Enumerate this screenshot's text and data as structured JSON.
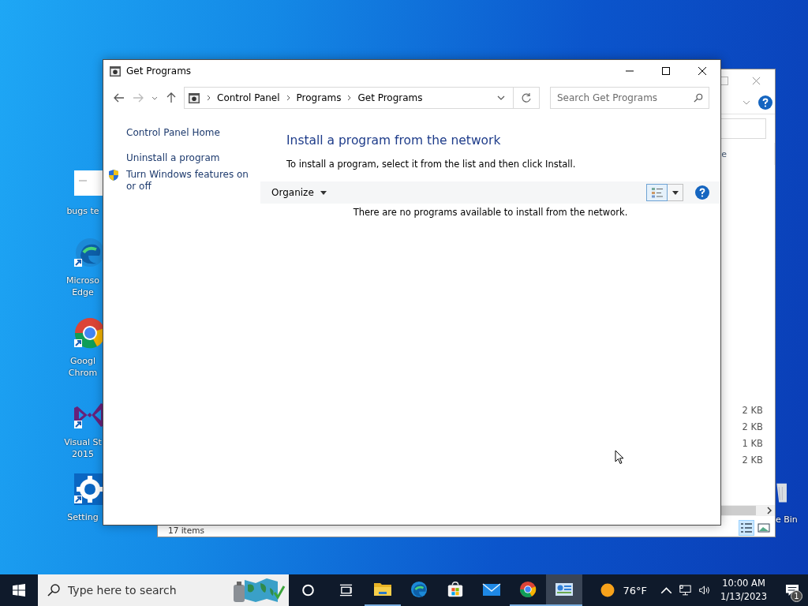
{
  "desktop_icons": [
    {
      "kind": "document",
      "label": "bugs te"
    },
    {
      "kind": "edge",
      "label": "Microso Edge"
    },
    {
      "kind": "chrome",
      "label": "Googl Chrom"
    },
    {
      "kind": "vs",
      "label": "Visual St 2015"
    },
    {
      "kind": "settings",
      "label": "Setting"
    }
  ],
  "recycle_bin": {
    "label": "e Bin"
  },
  "background_window": {
    "column_header": "e",
    "sizes": [
      "2 KB",
      "2 KB",
      "1 KB",
      "2 KB"
    ],
    "status": "17 items"
  },
  "window": {
    "title": "Get Programs",
    "breadcrumb": [
      "Control Panel",
      "Programs",
      "Get Programs"
    ],
    "search": {
      "placeholder": "Search Get Programs"
    },
    "sidebar": {
      "items": [
        {
          "label": "Control Panel Home",
          "shield": false
        },
        {
          "label": "Uninstall a program",
          "shield": false
        },
        {
          "label": "Turn Windows features on or off",
          "shield": true
        }
      ]
    },
    "heading": "Install a program from the network",
    "instruction": "To install a program, select it from the list and then click Install.",
    "toolbar": {
      "organize": "Organize"
    },
    "empty_message": "There are no programs available to install from the network."
  },
  "taskbar": {
    "search": {
      "placeholder": "Type here to search"
    },
    "apps": [
      {
        "kind": "explorer",
        "running": true,
        "selected": false
      },
      {
        "kind": "edge",
        "running": false,
        "selected": false
      },
      {
        "kind": "store",
        "running": false,
        "selected": false
      },
      {
        "kind": "mail",
        "running": false,
        "selected": false
      },
      {
        "kind": "chrome",
        "running": true,
        "selected": false
      },
      {
        "kind": "control-panel",
        "running": true,
        "selected": true
      }
    ],
    "weather": "76°F",
    "time": "10:00 AM",
    "date": "1/13/2023",
    "notifications": "1"
  }
}
